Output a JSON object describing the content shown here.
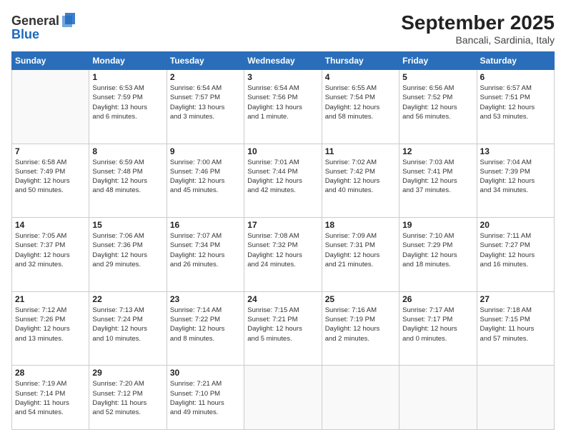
{
  "header": {
    "logo_general": "General",
    "logo_blue": "Blue",
    "title": "September 2025",
    "location": "Bancali, Sardinia, Italy"
  },
  "weekdays": [
    "Sunday",
    "Monday",
    "Tuesday",
    "Wednesday",
    "Thursday",
    "Friday",
    "Saturday"
  ],
  "weeks": [
    [
      {
        "day": "",
        "info": ""
      },
      {
        "day": "1",
        "info": "Sunrise: 6:53 AM\nSunset: 7:59 PM\nDaylight: 13 hours\nand 6 minutes."
      },
      {
        "day": "2",
        "info": "Sunrise: 6:54 AM\nSunset: 7:57 PM\nDaylight: 13 hours\nand 3 minutes."
      },
      {
        "day": "3",
        "info": "Sunrise: 6:54 AM\nSunset: 7:56 PM\nDaylight: 13 hours\nand 1 minute."
      },
      {
        "day": "4",
        "info": "Sunrise: 6:55 AM\nSunset: 7:54 PM\nDaylight: 12 hours\nand 58 minutes."
      },
      {
        "day": "5",
        "info": "Sunrise: 6:56 AM\nSunset: 7:52 PM\nDaylight: 12 hours\nand 56 minutes."
      },
      {
        "day": "6",
        "info": "Sunrise: 6:57 AM\nSunset: 7:51 PM\nDaylight: 12 hours\nand 53 minutes."
      }
    ],
    [
      {
        "day": "7",
        "info": "Sunrise: 6:58 AM\nSunset: 7:49 PM\nDaylight: 12 hours\nand 50 minutes."
      },
      {
        "day": "8",
        "info": "Sunrise: 6:59 AM\nSunset: 7:48 PM\nDaylight: 12 hours\nand 48 minutes."
      },
      {
        "day": "9",
        "info": "Sunrise: 7:00 AM\nSunset: 7:46 PM\nDaylight: 12 hours\nand 45 minutes."
      },
      {
        "day": "10",
        "info": "Sunrise: 7:01 AM\nSunset: 7:44 PM\nDaylight: 12 hours\nand 42 minutes."
      },
      {
        "day": "11",
        "info": "Sunrise: 7:02 AM\nSunset: 7:42 PM\nDaylight: 12 hours\nand 40 minutes."
      },
      {
        "day": "12",
        "info": "Sunrise: 7:03 AM\nSunset: 7:41 PM\nDaylight: 12 hours\nand 37 minutes."
      },
      {
        "day": "13",
        "info": "Sunrise: 7:04 AM\nSunset: 7:39 PM\nDaylight: 12 hours\nand 34 minutes."
      }
    ],
    [
      {
        "day": "14",
        "info": "Sunrise: 7:05 AM\nSunset: 7:37 PM\nDaylight: 12 hours\nand 32 minutes."
      },
      {
        "day": "15",
        "info": "Sunrise: 7:06 AM\nSunset: 7:36 PM\nDaylight: 12 hours\nand 29 minutes."
      },
      {
        "day": "16",
        "info": "Sunrise: 7:07 AM\nSunset: 7:34 PM\nDaylight: 12 hours\nand 26 minutes."
      },
      {
        "day": "17",
        "info": "Sunrise: 7:08 AM\nSunset: 7:32 PM\nDaylight: 12 hours\nand 24 minutes."
      },
      {
        "day": "18",
        "info": "Sunrise: 7:09 AM\nSunset: 7:31 PM\nDaylight: 12 hours\nand 21 minutes."
      },
      {
        "day": "19",
        "info": "Sunrise: 7:10 AM\nSunset: 7:29 PM\nDaylight: 12 hours\nand 18 minutes."
      },
      {
        "day": "20",
        "info": "Sunrise: 7:11 AM\nSunset: 7:27 PM\nDaylight: 12 hours\nand 16 minutes."
      }
    ],
    [
      {
        "day": "21",
        "info": "Sunrise: 7:12 AM\nSunset: 7:26 PM\nDaylight: 12 hours\nand 13 minutes."
      },
      {
        "day": "22",
        "info": "Sunrise: 7:13 AM\nSunset: 7:24 PM\nDaylight: 12 hours\nand 10 minutes."
      },
      {
        "day": "23",
        "info": "Sunrise: 7:14 AM\nSunset: 7:22 PM\nDaylight: 12 hours\nand 8 minutes."
      },
      {
        "day": "24",
        "info": "Sunrise: 7:15 AM\nSunset: 7:21 PM\nDaylight: 12 hours\nand 5 minutes."
      },
      {
        "day": "25",
        "info": "Sunrise: 7:16 AM\nSunset: 7:19 PM\nDaylight: 12 hours\nand 2 minutes."
      },
      {
        "day": "26",
        "info": "Sunrise: 7:17 AM\nSunset: 7:17 PM\nDaylight: 12 hours\nand 0 minutes."
      },
      {
        "day": "27",
        "info": "Sunrise: 7:18 AM\nSunset: 7:15 PM\nDaylight: 11 hours\nand 57 minutes."
      }
    ],
    [
      {
        "day": "28",
        "info": "Sunrise: 7:19 AM\nSunset: 7:14 PM\nDaylight: 11 hours\nand 54 minutes."
      },
      {
        "day": "29",
        "info": "Sunrise: 7:20 AM\nSunset: 7:12 PM\nDaylight: 11 hours\nand 52 minutes."
      },
      {
        "day": "30",
        "info": "Sunrise: 7:21 AM\nSunset: 7:10 PM\nDaylight: 11 hours\nand 49 minutes."
      },
      {
        "day": "",
        "info": ""
      },
      {
        "day": "",
        "info": ""
      },
      {
        "day": "",
        "info": ""
      },
      {
        "day": "",
        "info": ""
      }
    ]
  ]
}
